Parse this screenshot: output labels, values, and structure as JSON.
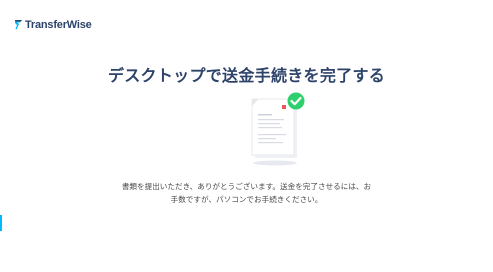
{
  "brand": {
    "name": "TransferWise",
    "logo_icon": "transferwise-flag-icon",
    "color": "#2e4369",
    "accent": "#00b9ff"
  },
  "main": {
    "title": "デスクトップで送金手続きを完了する",
    "illustration_icon": "document-checked-icon",
    "check_color": "#2ed06e",
    "message_line1": "書類を提出いただき、ありがとうございます。送金を完了させるには、お",
    "message_line2": "手数ですが、パソコンでお手続きください。"
  }
}
